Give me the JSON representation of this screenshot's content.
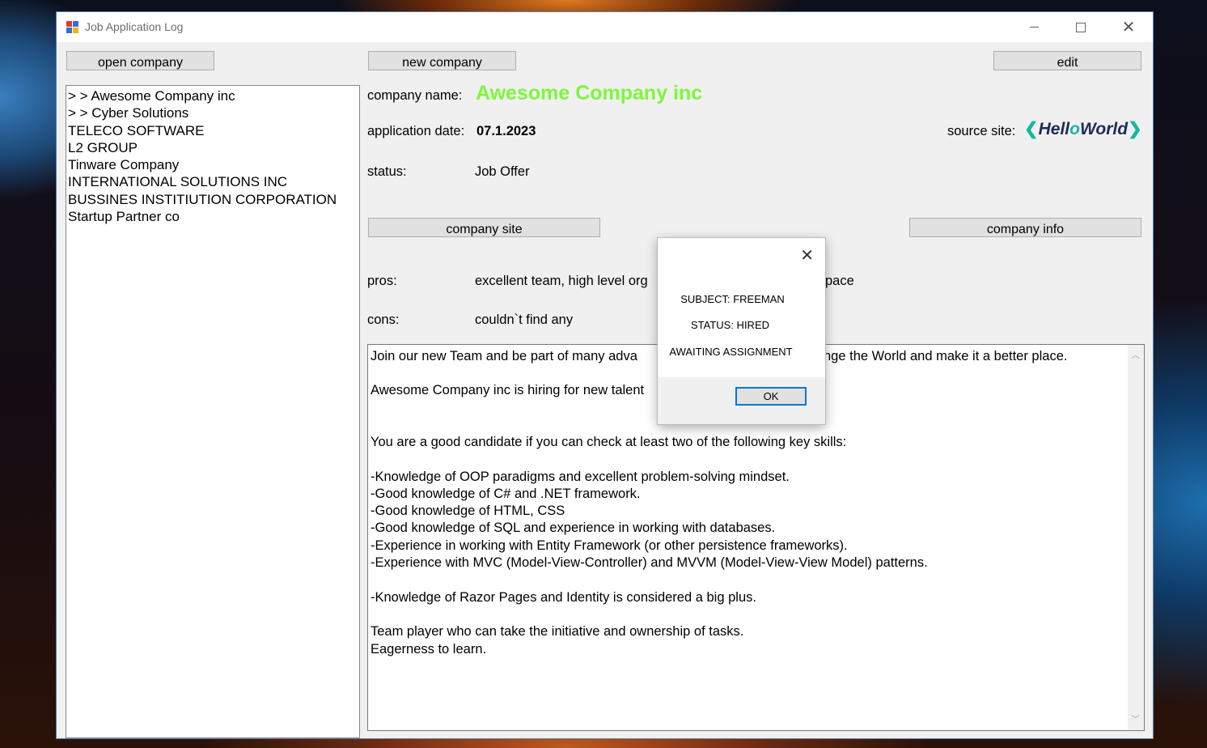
{
  "window": {
    "title": "Job Application Log"
  },
  "toolbar": {
    "open_company": "open company",
    "new_company": "new company",
    "edit": "edit",
    "company_site": "company site",
    "company_info": "company info"
  },
  "companies": [
    "> > Awesome Company inc",
    "> > Cyber Solutions",
    "TELECO SOFTWARE",
    "L2 GROUP",
    "Tinware Company",
    "INTERNATIONAL SOLUTIONS INC",
    "BUSSINES INSTITIUTION CORPORATION",
    "Startup Partner co"
  ],
  "details": {
    "company_name_label": "company name:",
    "company_name": "Awesome Company inc",
    "application_date_label": "application date:",
    "application_date": "07.1.2023",
    "source_site_label": "source site:",
    "source_site_logo": {
      "open": "❮",
      "part1": "Hell",
      "slash": "o",
      "part2": "World",
      "close": "❯"
    },
    "status_label": "status:",
    "status": "Job Offer",
    "pros_label": "pros:",
    "pros_visible_left": "excellent team, high level org",
    "pros_visible_right": "pace",
    "cons_label": "cons:",
    "cons": "couldn`t find any"
  },
  "description": {
    "line1_left": "Join our new Team and be part of many adva",
    "line1_right": "nge the World and make it a better place.",
    "line2": "Awesome Company inc is hiring for new talent",
    "body": "You are a good candidate if you can check at least two of the following key skills:\n\n-Knowledge of OOP paradigms and excellent problem-solving mindset.\n-Good knowledge of C# and .NET framework.\n-Good knowledge of HTML, CSS\n-Good knowledge of SQL and experience in working with databases.\n-Experience in working with Entity Framework (or other persistence frameworks).\n-Experience with MVC (Model-View-Controller) and MVVM (Model-View-View Model) patterns.\n\n-Knowledge of Razor Pages and Identity is considered a big plus.\n\nTeam player who can take the initiative and ownership of tasks.\nEagerness to learn."
  },
  "dialog": {
    "subject": "SUBJECT:  FREEMAN",
    "status": "STATUS:  HIRED",
    "message": "AWAITING ASSIGNMENT",
    "ok": "OK"
  },
  "colors": {
    "company_name": "#7cf83a",
    "accent_focus": "#0078d7"
  }
}
